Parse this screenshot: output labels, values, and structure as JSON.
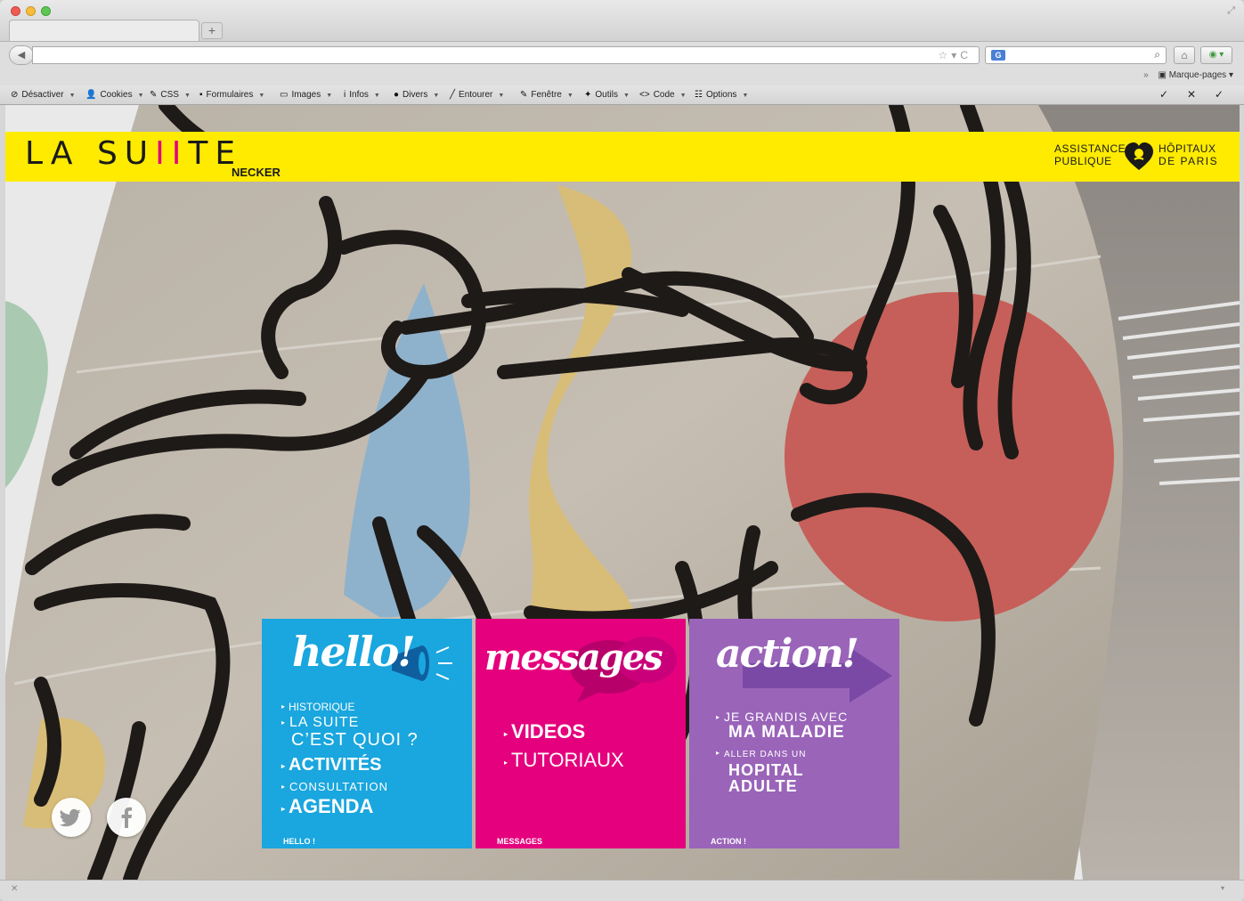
{
  "browser": {
    "devbar": {
      "items": [
        {
          "icon": "⊘",
          "label": "Désactiver"
        },
        {
          "icon": "👤",
          "label": "Cookies"
        },
        {
          "icon": "✎",
          "label": "CSS"
        },
        {
          "icon": "▪",
          "label": "Formulaires"
        },
        {
          "icon": "▭",
          "label": "Images"
        },
        {
          "icon": "i",
          "label": "Infos"
        },
        {
          "icon": "●",
          "label": "Divers"
        },
        {
          "icon": "╱",
          "label": "Entourer"
        },
        {
          "icon": "✎",
          "label": "Fenêtre"
        },
        {
          "icon": "✦",
          "label": "Outils"
        },
        {
          "icon": "<>",
          "label": "Code"
        },
        {
          "icon": "☷",
          "label": "Options"
        }
      ],
      "right_icons": [
        "✓",
        "✕",
        "✓"
      ]
    },
    "bookmarks_label": "Marque-pages",
    "search_engine": "G"
  },
  "site": {
    "logo_text_a": "LA SU",
    "logo_text_ii": "II",
    "logo_text_b": "TE",
    "logo_sub": "NECKER",
    "aphp_line1_left": "ASSISTANCE",
    "aphp_line2_left": "PUBLIQUE",
    "aphp_line1_right": "HÔPITAUX",
    "aphp_line2_right": "DE PARIS",
    "colors": {
      "yellow": "#ffeb00",
      "cyan": "#1aa6de",
      "magenta": "#e5007d",
      "purple": "#9a64b9"
    }
  },
  "cards": {
    "hello": {
      "title": "hello!",
      "footer": "HELLO !",
      "links": [
        "HISTORIQUE",
        "LA SUITE",
        "C’EST QUOI ?",
        "ACTIVITÉS",
        "CONSULTATION",
        "AGENDA"
      ]
    },
    "messages": {
      "title": "messages",
      "footer": "MESSAGES",
      "links": [
        "VIDEOS",
        "TUTORIAUX"
      ]
    },
    "action": {
      "title": "action!",
      "footer": "ACTION !",
      "links": [
        "JE GRANDIS AVEC",
        "MA MALADIE",
        "ALLER DANS UN",
        "HOPITAL",
        "ADULTE"
      ]
    }
  },
  "social": {
    "twitter": "twitter-icon",
    "facebook": "facebook-icon"
  }
}
